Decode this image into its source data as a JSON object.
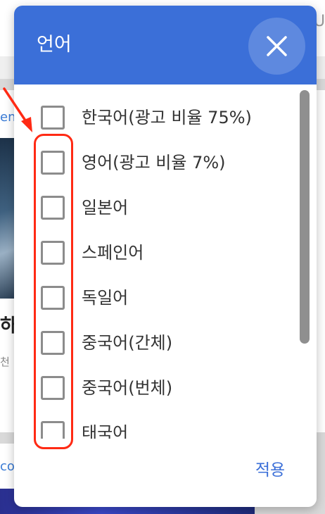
{
  "background": {
    "top_bar_text": "U",
    "link_text_1": "en",
    "bold_text_1": "하",
    "small_text_1": "천",
    "link_text_2": "co"
  },
  "dialog": {
    "title": "언어",
    "close_icon": "close-icon",
    "apply_label": "적용",
    "options": [
      {
        "label": "한국어(광고 비율 75%)",
        "checked": false
      },
      {
        "label": "영어(광고 비율 7%)",
        "checked": false
      },
      {
        "label": "일본어",
        "checked": false
      },
      {
        "label": "스페인어",
        "checked": false
      },
      {
        "label": "독일어",
        "checked": false
      },
      {
        "label": "중국어(간체)",
        "checked": false
      },
      {
        "label": "중국어(번체)",
        "checked": false
      },
      {
        "label": "태국어",
        "checked": false
      }
    ]
  },
  "colors": {
    "header": "#3b6fd8",
    "accent": "#3b6fd8",
    "annotation": "#ff2a14"
  }
}
